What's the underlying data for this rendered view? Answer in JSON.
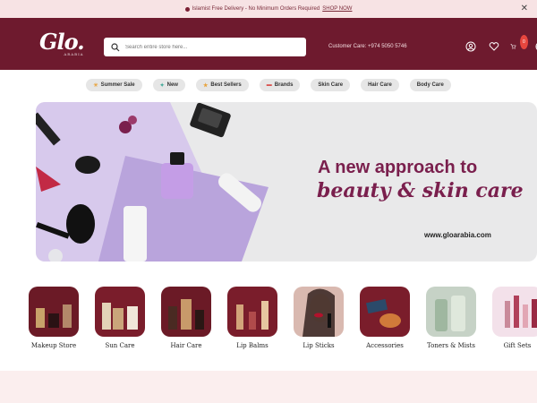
{
  "announcement": {
    "text": "Islamist Free Delivery - No Minimum Orders Required",
    "link": "SHOP NOW",
    "close": "✕"
  },
  "header": {
    "logo": "Glo.",
    "logo_sub": "ARABIA",
    "search_placeholder": "Search entire store here...",
    "customer_care": "Customer Care: +974 5050 5746",
    "cart_count": "0"
  },
  "nav": [
    {
      "label": "Summer Sale",
      "icon": "☀"
    },
    {
      "label": "New",
      "icon": "✦"
    },
    {
      "label": "Best Sellers",
      "icon": "★"
    },
    {
      "label": "Brands",
      "icon": "▬"
    },
    {
      "label": "Skin Care",
      "icon": ""
    },
    {
      "label": "Hair Care",
      "icon": ""
    },
    {
      "label": "Body Care",
      "icon": ""
    }
  ],
  "banner": {
    "headline": "A new approach to",
    "headline2": "beauty & skin care",
    "url": "www.gloarabia.com"
  },
  "categories": [
    {
      "label": "Makeup Store",
      "color": "#6b1a26"
    },
    {
      "label": "Sun Care",
      "color": "#7a1d2b"
    },
    {
      "label": "Hair Care",
      "color": "#6b1a26"
    },
    {
      "label": "Lip Balms",
      "color": "#7a1d2b"
    },
    {
      "label": "Lip Sticks",
      "color": "#d9b9b0"
    },
    {
      "label": "Accessories",
      "color": "#7a1d2b"
    },
    {
      "label": "Toners & Mists",
      "color": "#c6d2c6"
    },
    {
      "label": "Gift Sets",
      "color": "#f3e1ea"
    }
  ],
  "colors": {
    "brand": "#6e1a2e",
    "accent": "#7a1f4d"
  }
}
